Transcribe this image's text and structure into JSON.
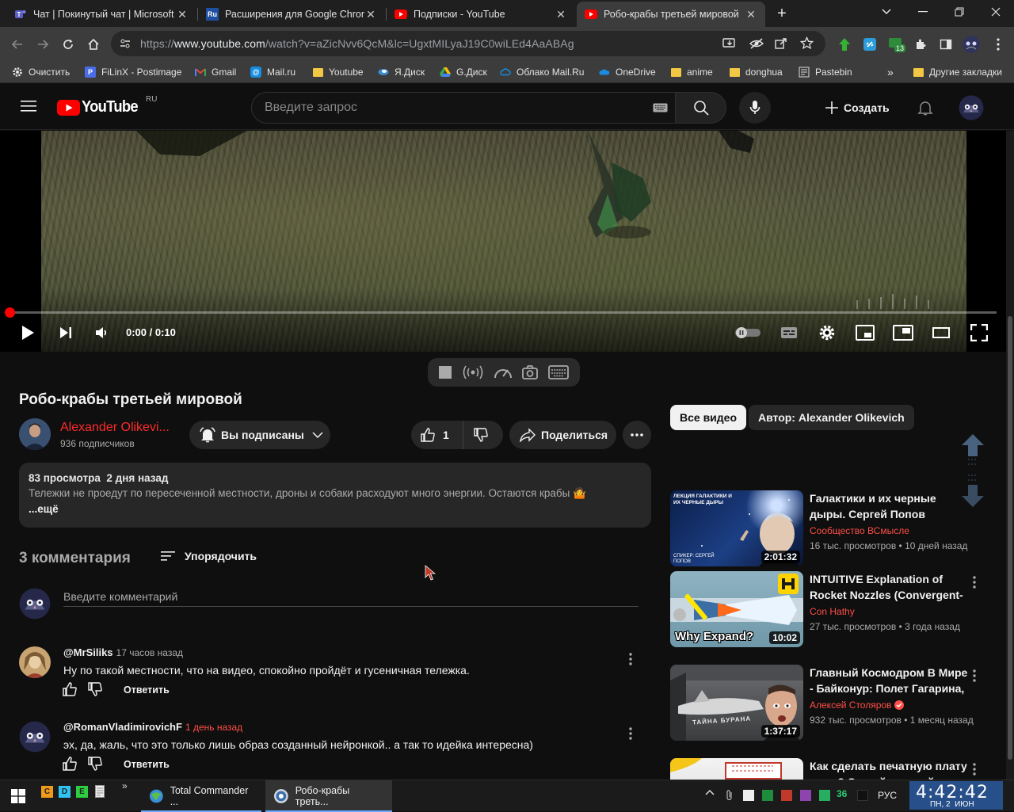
{
  "browser": {
    "tabs": [
      {
        "title": "Чат | Покинутый чат | Microsoft Teams",
        "favicon": "teams-icon",
        "active": false
      },
      {
        "title": "Расширения для Google Chrome",
        "favicon": "ru-icon",
        "active": false
      },
      {
        "title": "Подписки - YouTube",
        "favicon": "youtube-icon",
        "active": false
      },
      {
        "title": "Робо-крабы третьей мировой",
        "favicon": "youtube-icon",
        "active": true
      }
    ],
    "url_scheme": "https://",
    "url_host": "www.youtube.com",
    "url_path": "/watch?v=aZicNvv6QcM&lc=UgxtMILyaJ19C0wiLEd4AaABAg",
    "extension_badge": "13",
    "bookmarks": [
      {
        "label": "Очистить",
        "icon": "gear-icon"
      },
      {
        "label": "FiLinX - Postimage",
        "icon": "postimage-icon"
      },
      {
        "label": "Gmail",
        "icon": "gmail-icon"
      },
      {
        "label": "Mail.ru",
        "icon": "mailru-icon"
      },
      {
        "label": "Youtube",
        "icon": "folder-icon"
      },
      {
        "label": "Я.Диск",
        "icon": "yadisk-icon"
      },
      {
        "label": "G.Диск",
        "icon": "gdrive-icon"
      },
      {
        "label": "Облако Mail.Ru",
        "icon": "cloud-icon"
      },
      {
        "label": "OneDrive",
        "icon": "onedrive-icon"
      },
      {
        "label": "anime",
        "icon": "folder-icon"
      },
      {
        "label": "donghua",
        "icon": "folder-icon"
      },
      {
        "label": "Pastebin",
        "icon": "pastebin-icon"
      }
    ],
    "bookmarks_overflow": "»",
    "other_bookmarks": "Другие закладки"
  },
  "youtube": {
    "logo_text": "YouTube",
    "region": "RU",
    "search_placeholder": "Введите запрос",
    "create_label": "Создать",
    "player": {
      "time": "0:00 / 0:10",
      "progress": 0.0
    },
    "video": {
      "title": "Робо-крабы третьей мировой",
      "channel": "Alexander Olikevi...",
      "subscribers": "936 подписчиков",
      "subscribed_label": "Вы подписаны",
      "likes": "1",
      "share_label": "Поделиться",
      "views": "83 просмотра",
      "date": "2 дня назад",
      "description": "Тележки не проедут по пересеченной местности, дроны и собаки расходуют много энергии. Остаются крабы 🤷",
      "more": "...ещё"
    },
    "comments": {
      "count": "3 комментария",
      "sort_label": "Упорядочить",
      "input_placeholder": "Введите комментарий",
      "reply_label": "Ответить",
      "items": [
        {
          "author": "@MrSiliks",
          "time": "17 часов назад",
          "text": "Ну по такой местности, что на видео, спокойно пройдёт и гусеничная тележка."
        },
        {
          "author": "@RomanVladimirovichF",
          "time": "1 день назад",
          "text": "эх, да, жаль, что это только лишь образ созданный нейронкой..  а так то идейка интересна)"
        }
      ]
    },
    "chips": [
      {
        "label": "Все видео",
        "selected": true
      },
      {
        "label": "Автор: Alexander Olikevich",
        "selected": false
      }
    ],
    "recommendations": [
      {
        "title": "Галактики и их черные дыры. Сергей Попов",
        "channel": "Сообщество ВСмысле",
        "meta": "16 тыс. просмотров • 10 дней назад",
        "duration": "2:01:32",
        "thumb_caption": "ЛЕКЦИЯ ГАЛАКТИКИ И ИХ ЧЕРНЫЕ ДЫРЫ",
        "thumb_sub": "СПИКЕР: СЕРГЕЙ ПОПОВ"
      },
      {
        "title": "INTUITIVE Explanation of Rocket Nozzles (Convergent-Divergent)",
        "channel": "Con Hathy",
        "meta": "27 тыс. просмотров • 3 года назад",
        "duration": "10:02",
        "thumb_caption": "Why Expand?"
      },
      {
        "title": "Главный Космодром В Мире - Байконур: Полет Гагарина, Буран",
        "channel": "Алексей Столяров",
        "meta": "932 тыс. просмотров • 1 месяц назад",
        "duration": "1:37:17",
        "thumb_caption": "ТАЙНА БУРАНА"
      },
      {
        "title": "Как сделать печатную плату дома? Самый простой способ",
        "channel": "",
        "meta": "",
        "duration": ""
      }
    ]
  },
  "taskbar": {
    "apps": [
      {
        "label": "Total Commander ...",
        "icon": "total-commander-icon"
      },
      {
        "label": "Робо-крабы треть...",
        "icon": "chrome-icon"
      }
    ],
    "drives": [
      "C",
      "D",
      "E"
    ],
    "tray_number": "36",
    "language": "РУС",
    "time": "4:42:42",
    "date": "ПН, 2  ИЮН"
  }
}
